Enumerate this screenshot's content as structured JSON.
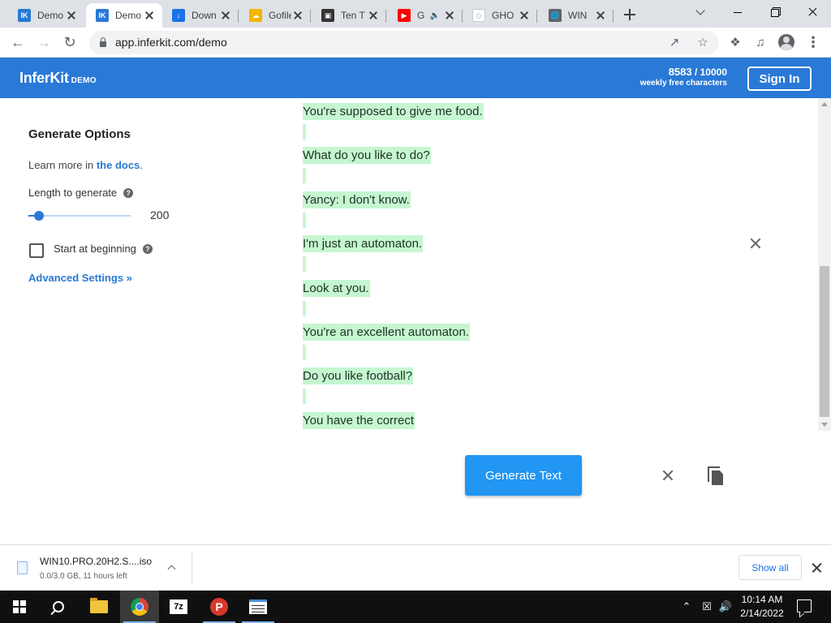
{
  "browser": {
    "tabs": [
      {
        "title": "Demo",
        "favicon": "inferkit-icon",
        "favicon_color": "#2979d6",
        "favicon_text": "IK",
        "active": false
      },
      {
        "title": "Demo",
        "favicon": "inferkit-icon",
        "favicon_color": "#2979d6",
        "favicon_text": "IK",
        "active": true
      },
      {
        "title": "Down",
        "favicon": "download-icon",
        "favicon_color": "#1a73e8",
        "favicon_text": "↓",
        "active": false
      },
      {
        "title": "Gofile",
        "favicon": "gofile-icon",
        "favicon_color": "#f4b400",
        "favicon_text": "☁",
        "active": false
      },
      {
        "title": "Ten T",
        "favicon": "camera-icon",
        "favicon_color": "#333333",
        "favicon_text": "▣",
        "active": false
      },
      {
        "title": "G",
        "favicon": "youtube-icon",
        "favicon_color": "#ff0000",
        "favicon_text": "▶",
        "active": false,
        "muted_icon": "🔈"
      },
      {
        "title": "GHO",
        "favicon": "ghost-icon",
        "favicon_color": "#ffffff",
        "favicon_text": "◇",
        "active": false
      },
      {
        "title": "WIN",
        "favicon": "globe-icon",
        "favicon_color": "#5f6368",
        "favicon_text": "🌐",
        "active": false
      }
    ],
    "url": "app.inferkit.com/demo"
  },
  "header": {
    "brand": "InferKit",
    "brand_suffix": "DEMO",
    "quota_used": "8583",
    "quota_total": "10000",
    "quota_label": "weekly free characters",
    "signin_label": "Sign In",
    "color": "#2979d6"
  },
  "options": {
    "title": "Generate Options",
    "learn_prefix": "Learn more in ",
    "learn_link": "the docs",
    "learn_suffix": ".",
    "length_label": "Length to generate",
    "length_value": "200",
    "length_fraction": 0.1,
    "start_label": "Start at beginning",
    "start_checked": false,
    "advanced_label": "Advanced Settings »",
    "help_glyph": "?"
  },
  "generated_lines": [
    "You're supposed to give me food.",
    "What do you like to do?",
    "Yancy: I don't know.",
    "I'm just an automaton.",
    "Look at you.",
    "You're an excellent automaton.",
    "Do you like football?",
    "You have the correct"
  ],
  "generate_button": "Generate Text",
  "download": {
    "filename": "WIN10.PRO.20H2.S....iso",
    "status": "0.0/3.0 GB, 11 hours left",
    "show_all": "Show all"
  },
  "taskbar": {
    "sevenzip_label": "7z",
    "psiphon_label": "P",
    "time": "10:14 AM",
    "date": "2/14/2022"
  }
}
